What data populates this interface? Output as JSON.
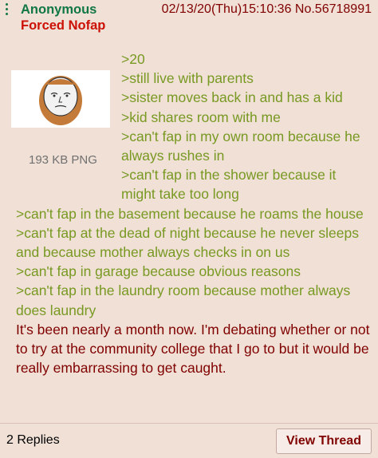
{
  "post": {
    "name": "Anonymous",
    "subject": "Forced Nofap",
    "datetime": "02/13/20(Thu)15:10:36 No.56718991",
    "file_size": "193 KB PNG",
    "greentext": [
      ">20",
      ">still live with parents",
      ">sister moves back in and has a kid",
      ">kid shares room with me",
      ">can't fap in my own room because he always rushes in",
      ">can't fap in the shower because it might take too long",
      ">can't fap in the basement because he roams the house",
      ">can't fap at the dead of night because he never sleeps and because mother always checks in on us",
      ">can't fap in garage because obvious reasons",
      ">can't fap in the laundry room because mother always does laundry"
    ],
    "comment": "It's been nearly a month now. I'm debating whether or not to try at the community college that I go to but it would be really embarrassing to get caught."
  },
  "footer": {
    "replies": "2 Replies",
    "view_thread": "View Thread"
  },
  "colors": {
    "background": "#f0e0d6",
    "name": "#117743",
    "subject": "#cc1105",
    "greentext": "#789922",
    "text": "#800000"
  },
  "icons": {
    "menu": "vertical-dots-menu-icon",
    "thumbnail": "wojak-face-thumbnail"
  }
}
